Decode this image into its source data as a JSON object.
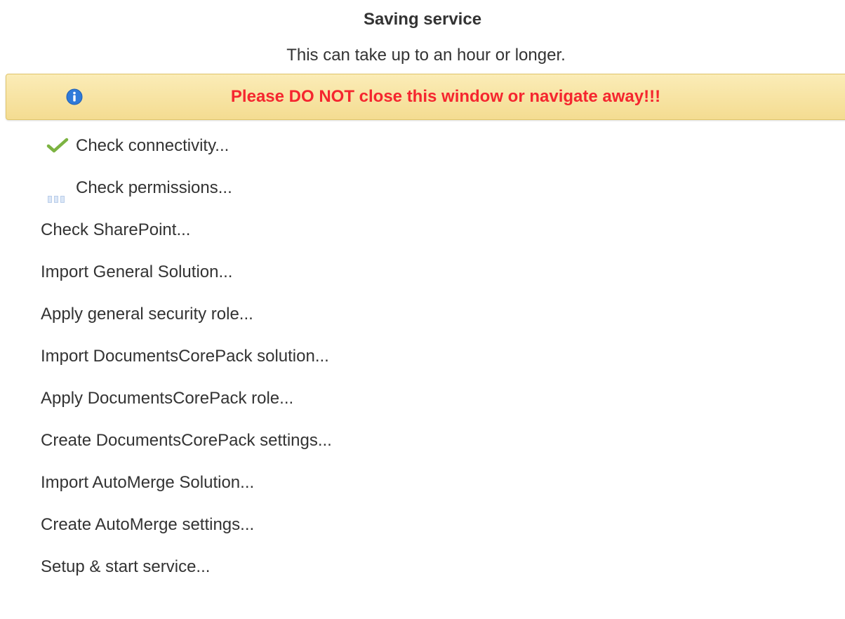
{
  "dialog": {
    "title": "Saving service",
    "subtitle": "This can take up to an hour or longer.",
    "warning": {
      "icon": "info-icon",
      "text": "Please DO NOT close this window or navigate away!!!",
      "text_color": "#f5262f",
      "background": "#f8e4a4"
    },
    "steps": [
      {
        "label": "Check connectivity...",
        "status": "done",
        "icon": "checkmark-icon"
      },
      {
        "label": "Check permissions...",
        "status": "in-progress",
        "icon": "progress-dots-icon"
      },
      {
        "label": "Check SharePoint...",
        "status": "pending"
      },
      {
        "label": "Import General Solution...",
        "status": "pending"
      },
      {
        "label": "Apply general security role...",
        "status": "pending"
      },
      {
        "label": "Import DocumentsCorePack solution...",
        "status": "pending"
      },
      {
        "label": "Apply DocumentsCorePack role...",
        "status": "pending"
      },
      {
        "label": "Create DocumentsCorePack settings...",
        "status": "pending"
      },
      {
        "label": "Import AutoMerge Solution...",
        "status": "pending"
      },
      {
        "label": "Create AutoMerge settings...",
        "status": "pending"
      },
      {
        "label": "Setup & start service...",
        "status": "pending"
      }
    ]
  }
}
